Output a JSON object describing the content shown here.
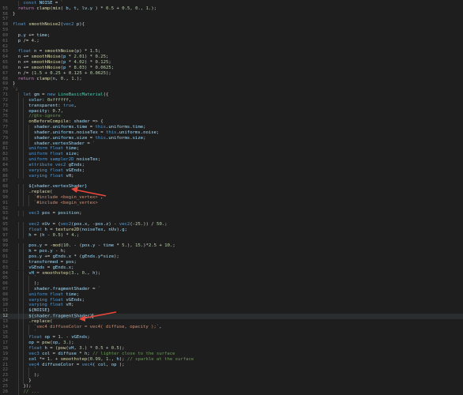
{
  "editor": {
    "lines": [
      {
        "n": "",
        "t": "    const NOISE = `"
      },
      {
        "n": "55",
        "t": "  return clamp(mix( b, t, lv.y ) * 0.5 + 0.5, 0., 1.);"
      },
      {
        "n": "56",
        "t": "}"
      },
      {
        "n": "57",
        "t": ""
      },
      {
        "n": "58",
        "t": "float smoothNoise2(vec2 p){"
      },
      {
        "n": "59",
        "t": ""
      },
      {
        "n": "60",
        "t": "  p.y += time;"
      },
      {
        "n": "61",
        "t": "  p /= 4.;"
      },
      {
        "n": "62",
        "t": ""
      },
      {
        "n": "63",
        "t": "  float n = smoothNoise(p) * 1.5;"
      },
      {
        "n": "64",
        "t": "  n += smoothNoise(p * 2.01) * 0.25;"
      },
      {
        "n": "65",
        "t": "  n += smoothNoise(p * 4.02) * 0.125;"
      },
      {
        "n": "66",
        "t": "  n += smoothNoise(p * 8.03) * 0.0625;"
      },
      {
        "n": "67",
        "t": "  n /= (1.5 + 0.25 + 0.125 + 0.0625);"
      },
      {
        "n": "68",
        "t": "  return clamp(n, 0., 1.);"
      },
      {
        "n": "69",
        "t": "}"
      },
      {
        "n": "70",
        "t": "`;"
      },
      {
        "n": "71",
        "t": "    let gm = new LineBasicMaterial({"
      },
      {
        "n": "72",
        "t": "      color: 0xffffff,"
      },
      {
        "n": "73",
        "t": "      transparent: true,"
      },
      {
        "n": "74",
        "t": "      opacity: 0.7,"
      },
      {
        "n": "75",
        "t": "      //@ts-ignore"
      },
      {
        "n": "76",
        "t": "      onBeforeCompile: shader => {"
      },
      {
        "n": "77",
        "t": "        shader.uniforms.time = this.uniforms.time;"
      },
      {
        "n": "78",
        "t": "        shader.uniforms.noiseTex = this.uniforms.noise;"
      },
      {
        "n": "79",
        "t": "        shader.uniforms.size = this.uniforms.size;"
      },
      {
        "n": "80",
        "t": "        shader.vertexShader = `"
      },
      {
        "n": "81",
        "t": "      uniform float time;"
      },
      {
        "n": "82",
        "t": "      uniform float size;"
      },
      {
        "n": "83",
        "t": "      uniform sampler2D noiseTex;"
      },
      {
        "n": "84",
        "t": "      attribute vec2 gEnds;"
      },
      {
        "n": "85",
        "t": "      varying float vGEnds;"
      },
      {
        "n": "86",
        "t": "      varying float vH;"
      },
      {
        "n": "87",
        "t": ""
      },
      {
        "n": "88",
        "t": "      ${shader.vertexShader}"
      },
      {
        "n": "89",
        "t": "      .replace("
      },
      {
        "n": "90",
        "t": "        `#include <begin_vertex>`,"
      },
      {
        "n": "91",
        "t": "        `#include <begin_vertex>"
      },
      {
        "n": "92",
        "t": ""
      },
      {
        "n": "93",
        "t": "      vec3 pos = position;"
      },
      {
        "n": "94",
        "t": ""
      },
      {
        "n": "95",
        "t": "      vec2 nUv = (vec2(pos.x, -pos.z) - vec2(-25.)) / 50.;"
      },
      {
        "n": "96",
        "t": "      float h = texture2D(noiseTex, nUv).g;"
      },
      {
        "n": "97",
        "t": "      h = (h - 0.5) * 4.;"
      },
      {
        "n": "98",
        "t": ""
      },
      {
        "n": "99",
        "t": "      pos.y = -mod(10. - (pos.y - time * 5.), 15.)*2.5 + 10.;"
      },
      {
        "n": "00",
        "t": "      h = pos.y - h;"
      },
      {
        "n": "01",
        "t": "      pos.y += gEnds.x * (gEnds.y*size);"
      },
      {
        "n": "02",
        "t": "      transformed = pos;"
      },
      {
        "n": "03",
        "t": "      vGEnds = gEnds.x;"
      },
      {
        "n": "04",
        "t": "      vH = smoothstep(3., 0., h);"
      },
      {
        "n": "05",
        "t": "        `"
      },
      {
        "n": "06",
        "t": "        );"
      },
      {
        "n": "07",
        "t": "        shader.fragmentShader = `"
      },
      {
        "n": "08",
        "t": "      uniform float time;"
      },
      {
        "n": "09",
        "t": "      varying float vGEnds;"
      },
      {
        "n": "10",
        "t": "      varying float vH;"
      },
      {
        "n": "11",
        "t": "      ${NOISE}"
      },
      {
        "n": "12",
        "t": "      ${shader.fragmentShader}"
      },
      {
        "n": "13",
        "t": "      .replace("
      },
      {
        "n": "14",
        "t": "        `vec4 diffuseColor = vec4( diffuse, opacity );`,"
      },
      {
        "n": "15",
        "t": "        `"
      },
      {
        "n": "16",
        "t": "      float op = 1. - vGEnds;"
      },
      {
        "n": "17",
        "t": "      op = pow(op, 3.);"
      },
      {
        "n": "18",
        "t": "      float h = (pow(vH, 3.) * 0.5 + 0.5);"
      },
      {
        "n": "19",
        "t": "      vec3 col = diffuse * h; // lighter close to the surface"
      },
      {
        "n": "20",
        "t": "      col *= 1. + smoothstep(0.99, 1., h); // sparkle at the surface"
      },
      {
        "n": "21",
        "t": "      vec4 diffuseColor = vec4( col, op );"
      },
      {
        "n": "22",
        "t": "        `"
      },
      {
        "n": "23",
        "t": "        );"
      },
      {
        "n": "24",
        "t": "      }"
      },
      {
        "n": "25",
        "t": "    });"
      },
      {
        "n": "26",
        "t": "    // ..."
      }
    ]
  },
  "colors": {
    "keyword": "#569cd6",
    "control": "#c586c0",
    "function": "#dcdcaa",
    "type": "#4ec9b0",
    "string": "#ce9178",
    "number": "#b5cea8",
    "comment": "#6a9955",
    "variable": "#9cdcfe",
    "plain": "#d4d4d4",
    "template_bg": "#1e1e1e",
    "annotation_arrow": "#e8473b"
  }
}
